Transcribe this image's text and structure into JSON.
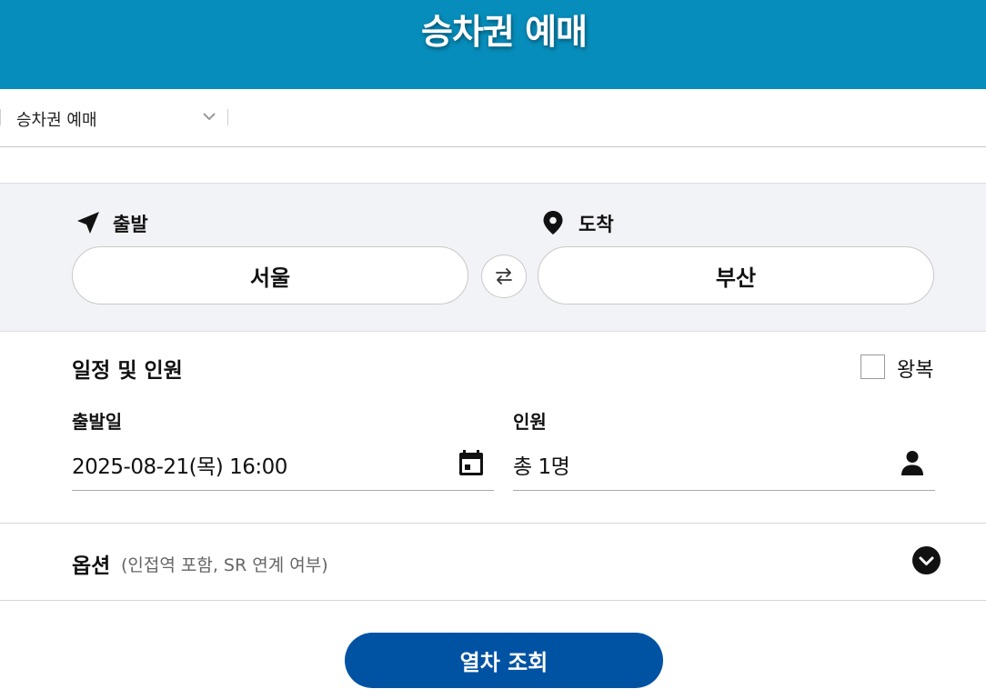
{
  "header": {
    "title": "승차권 예매"
  },
  "breadcrumb": {
    "label": "승차권 예매",
    "dropdown_icon": "chevron-down-icon"
  },
  "route": {
    "departure_label": "출발",
    "departure_icon": "navigation-arrow-icon",
    "departure_station": "서울",
    "arrival_label": "도착",
    "arrival_icon": "map-pin-icon",
    "arrival_station": "부산",
    "swap_icon": "swap-arrows-icon"
  },
  "schedule": {
    "section_title": "일정 및 인원",
    "roundtrip_label": "왕복",
    "roundtrip_checked": false,
    "date_label": "출발일",
    "date_value": "2025-08-21(목) 16:00",
    "date_icon": "calendar-icon",
    "passenger_label": "인원",
    "passenger_value": "총 1명",
    "passenger_icon": "person-icon"
  },
  "options": {
    "title": "옵션",
    "subtitle": "(인접역 포함, SR 연계 여부)",
    "toggle_icon": "chevron-circle-down-icon"
  },
  "search_button": {
    "label": "열차 조회"
  },
  "colors": {
    "header_bg": "#078dbb",
    "route_panel_bg": "#f2f3f7",
    "primary_button": "#0052a3"
  }
}
